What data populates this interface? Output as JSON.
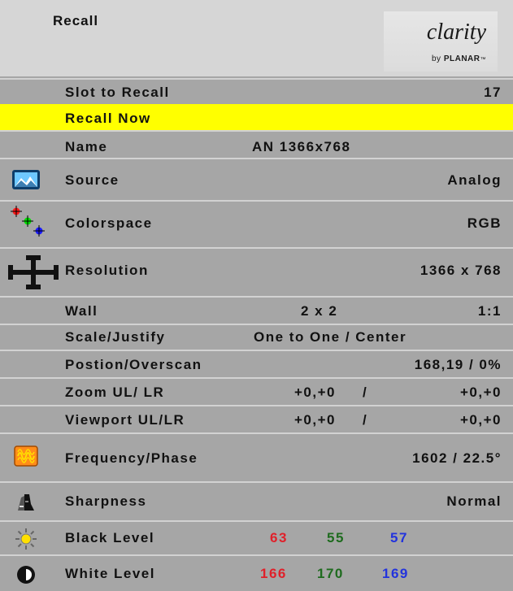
{
  "header": {
    "title": "Recall",
    "logo_word": "clarity",
    "logo_by": "by",
    "logo_brand": "PLANAR",
    "logo_tm": "™"
  },
  "rows": {
    "slot": {
      "label": "Slot to Recall",
      "value": "17"
    },
    "recall_now": {
      "label": "Recall Now"
    },
    "name": {
      "label": "Name",
      "value": "AN 1366x768"
    },
    "source": {
      "label": "Source",
      "value": "Analog",
      "icon": "landscape-icon"
    },
    "colorspace": {
      "label": "Colorspace",
      "value": "RGB",
      "icon": "color-dots-icon"
    },
    "resolution": {
      "label": "Resolution",
      "value": "1366 x 768",
      "icon": "resolution-arrows-icon"
    },
    "wall": {
      "label": "Wall",
      "value1": "2 x 2",
      "value2": "1:1"
    },
    "scale": {
      "label": "Scale/Justify",
      "value": "One to One / Center"
    },
    "position": {
      "label": "Postion/Overscan",
      "value": "168,19 / 0%"
    },
    "zoom": {
      "label": "Zoom UL/ LR",
      "ul": "+0,+0",
      "sep": "/",
      "lr": "+0,+0"
    },
    "viewport": {
      "label": "Viewport UL/LR",
      "ul": "+0,+0",
      "sep": "/",
      "lr": "+0,+0"
    },
    "frequency": {
      "label": "Frequency/Phase",
      "value": "1602 / 22.5°",
      "icon": "waveform-icon"
    },
    "sharpness": {
      "label": "Sharpness",
      "value": "Normal",
      "icon": "sharpness-icon"
    },
    "black": {
      "label": "Black Level",
      "r": "63",
      "g": "55",
      "b": "57",
      "icon": "sun-icon"
    },
    "white": {
      "label": "White Level",
      "r": "166",
      "g": "170",
      "b": "169",
      "icon": "contrast-icon"
    }
  },
  "colors": {
    "highlight": "#ffff00",
    "panel": "#a6a6a6",
    "header": "#d6d6d6",
    "red": "#e0202a",
    "green": "#1e6b1e",
    "blue": "#2233dd"
  }
}
